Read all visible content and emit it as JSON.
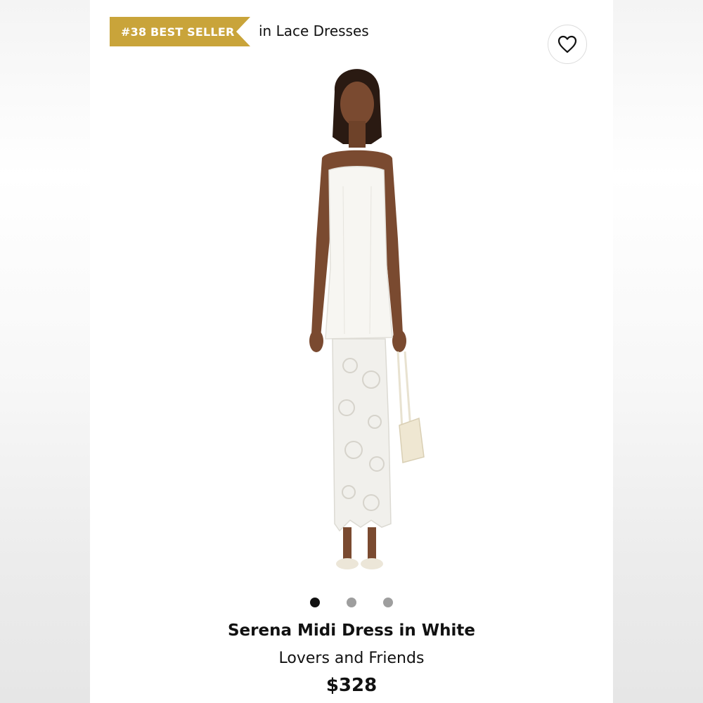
{
  "badge": {
    "rank_label": "#38 BEST SELLER",
    "category_text": "in Lace Dresses",
    "color": "#c9a43a"
  },
  "wishlist": {
    "icon": "heart-icon"
  },
  "gallery": {
    "image_count": 3,
    "active_index": 0
  },
  "product": {
    "name": "Serena Midi Dress in White",
    "brand": "Lovers and Friends",
    "price": "$328"
  }
}
